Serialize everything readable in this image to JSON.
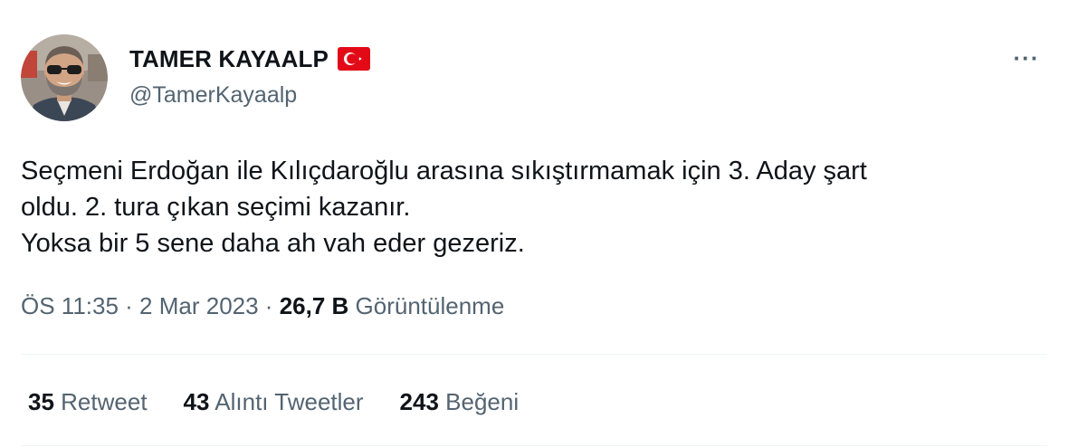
{
  "author": {
    "display_name": "TAMER KAYAALP",
    "handle": "@TamerKayaalp",
    "flag_icon": "turkey-flag-icon"
  },
  "tweet": {
    "lines": [
      "Seçmeni Erdoğan ile Kılıçdaroğlu arasına sıkıştırmamak için 3. Aday şart",
      "oldu. 2. tura çıkan seçimi kazanır.",
      "Yoksa bir 5 sene daha ah vah eder gezeriz."
    ]
  },
  "meta": {
    "time": "ÖS 11:35",
    "separator": " · ",
    "date": "2 Mar 2023",
    "views_count": "26,7 B",
    "views_label": "Görüntülenme"
  },
  "stats": {
    "retweets_count": "35",
    "retweets_label": "Retweet",
    "quotes_count": "43",
    "quotes_label": "Alıntı Tweetler",
    "likes_count": "243",
    "likes_label": "Beğeni"
  },
  "colors": {
    "text_primary": "#0f1419",
    "text_secondary": "#536471",
    "divider": "#eff3f4",
    "flag_red": "#e30a17"
  }
}
